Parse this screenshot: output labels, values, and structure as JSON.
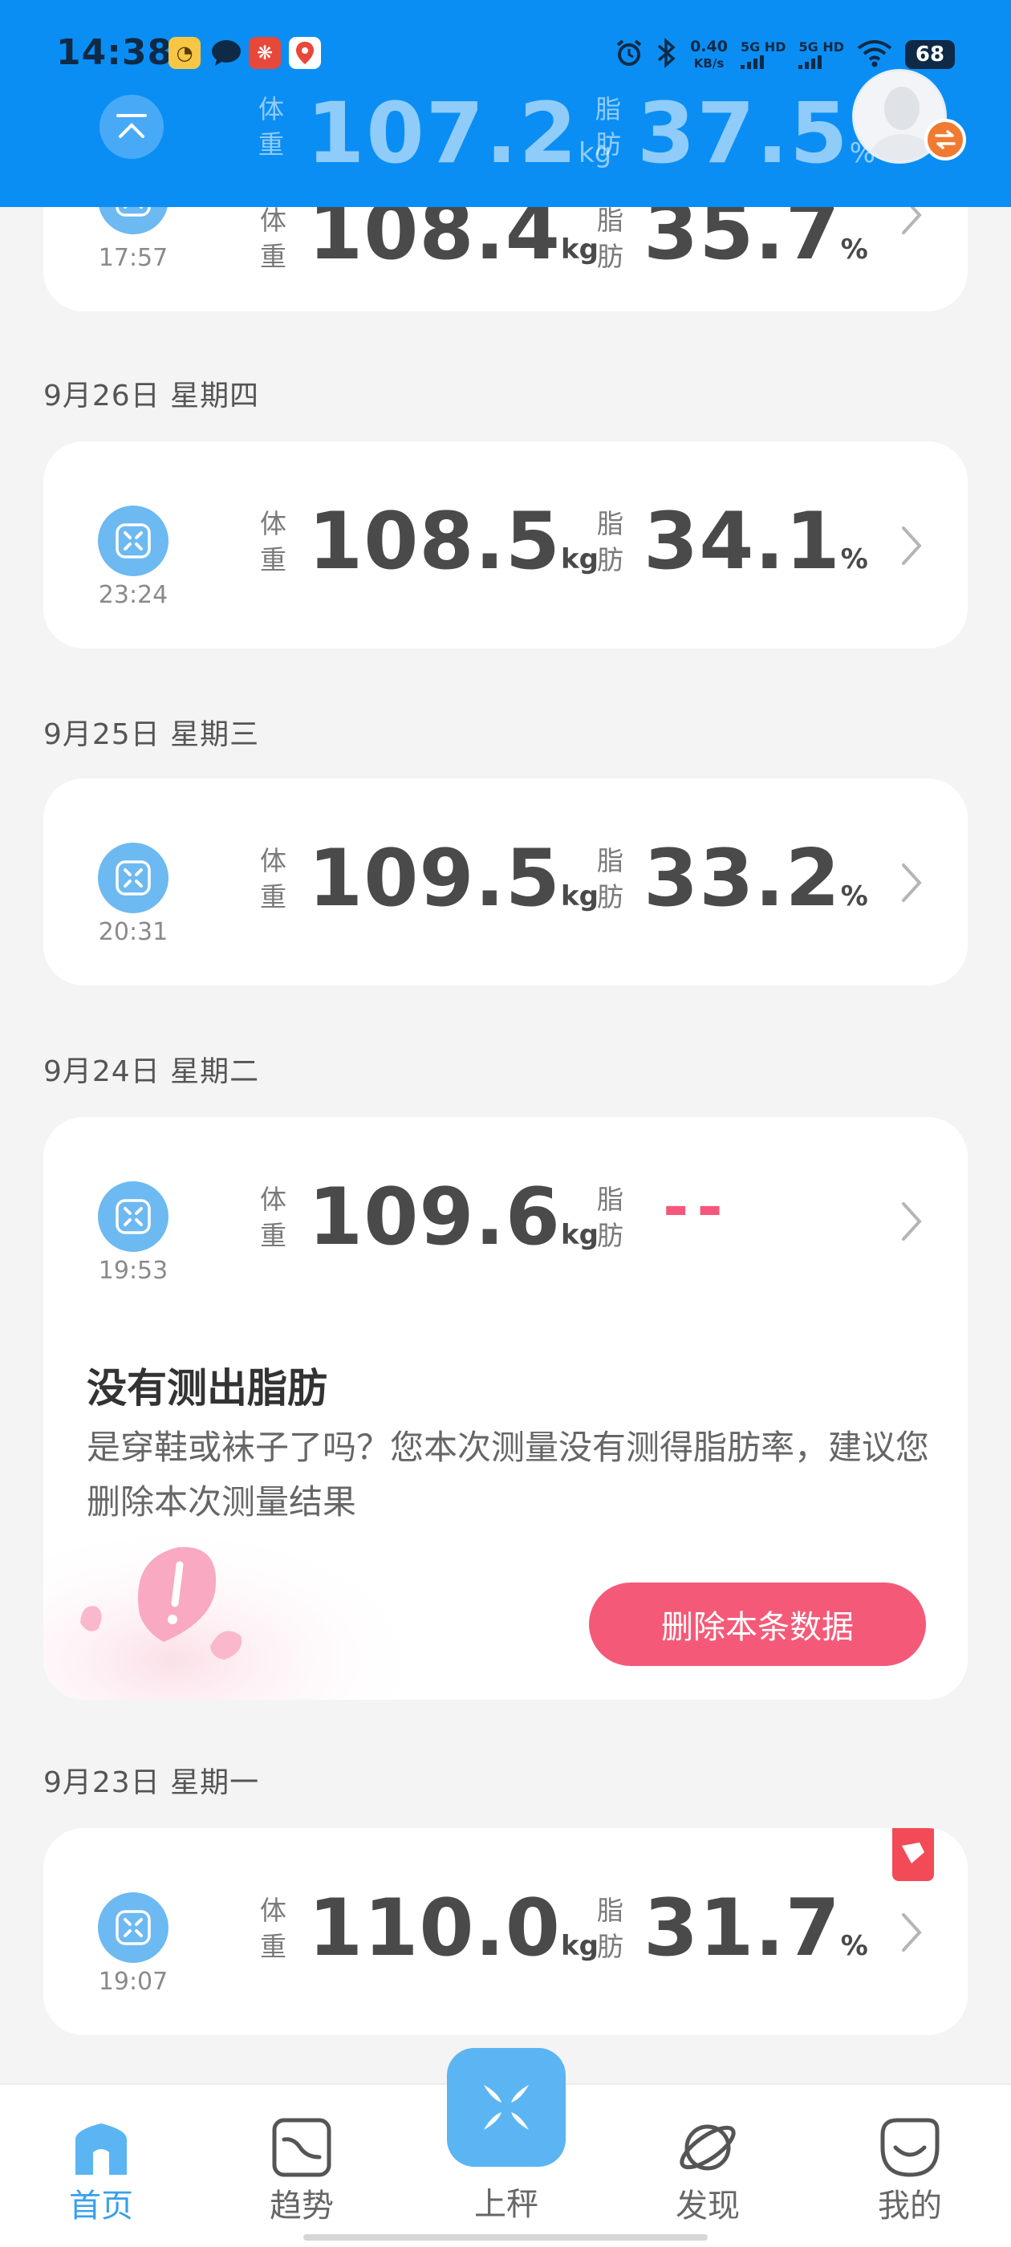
{
  "status_bar": {
    "time": "14:38",
    "net_speed_value": "0.40",
    "net_speed_unit": "KB/s",
    "sim1": "5G HD",
    "sim2": "5G HD",
    "battery": "68"
  },
  "summary": {
    "weight_label": "体重",
    "weight_value": "107.2",
    "weight_unit": "kg",
    "fat_label": "脂肪",
    "fat_value": "37.5",
    "fat_unit": "%"
  },
  "labels": {
    "weight": "体重",
    "fat": "脂肪",
    "kg": "kg",
    "percent": "%"
  },
  "records": [
    {
      "date": "",
      "time": "17:57",
      "weight": "108.4",
      "fat": "35.7"
    },
    {
      "date": "9月26日  星期四",
      "time": "23:24",
      "weight": "108.5",
      "fat": "34.1"
    },
    {
      "date": "9月25日  星期三",
      "time": "20:31",
      "weight": "109.5",
      "fat": "33.2"
    },
    {
      "date": "9月24日  星期二",
      "time": "19:53",
      "weight": "109.6",
      "fat": "--",
      "warning_title": "没有测出脂肪",
      "warning_body": "是穿鞋或袜子了吗？您本次测量没有测得脂肪率，建议您删除本次测量结果",
      "delete_label": "删除本条数据"
    },
    {
      "date": "9月23日  星期一",
      "time": "19:07",
      "weight": "110.0",
      "fat": "31.7"
    }
  ],
  "nav": {
    "home": "首页",
    "trend": "趋势",
    "weigh": "上秤",
    "discover": "发现",
    "mine": "我的"
  },
  "colors": {
    "header_bg": "#0b8ef3",
    "accent": "#38a0ee",
    "scale_icon": "#6db9f1",
    "delete_button": "#f45a78",
    "no_fat_dash": "#f5577a"
  }
}
